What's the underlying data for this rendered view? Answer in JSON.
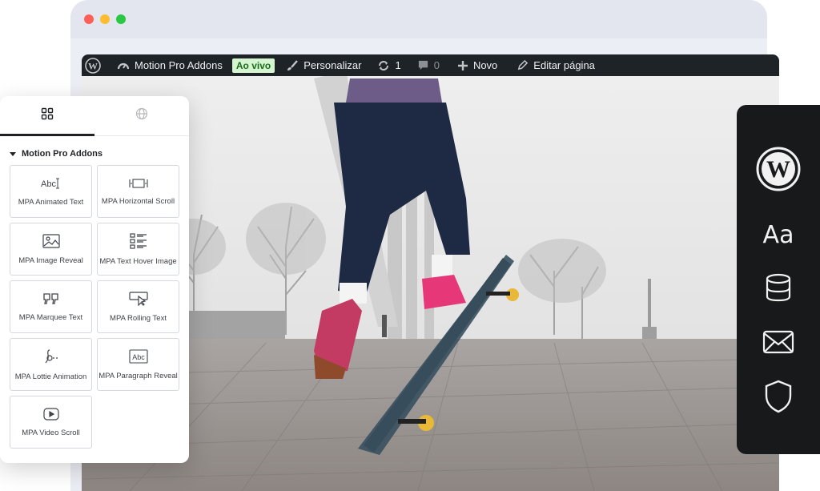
{
  "browser": {
    "dots": [
      "#fe5f57",
      "#febc2e",
      "#28c840"
    ]
  },
  "adminbar": {
    "site_name": "Motion Pro Addons",
    "live_badge": "Ao vivo",
    "customize": "Personalizar",
    "updates_count": "1",
    "comments_count": "0",
    "new_label": "Novo",
    "edit_page": "Editar página",
    "icons": [
      "wordpress-icon",
      "dashboard-icon",
      "brush-icon",
      "refresh-icon",
      "comment-icon",
      "plus-icon",
      "pencil-icon"
    ]
  },
  "panel": {
    "tabs": [
      {
        "icon": "grid-icon",
        "active": true
      },
      {
        "icon": "globe-icon",
        "active": false
      }
    ],
    "section_title": "Motion Pro Addons",
    "widgets": [
      {
        "label": "MPA Animated Text",
        "icon": "animated-text-icon"
      },
      {
        "label": "MPA Horizontal Scroll",
        "icon": "horizontal-scroll-icon"
      },
      {
        "label": "MPA Image Reveal",
        "icon": "image-icon"
      },
      {
        "label": "MPA Text Hover Image",
        "icon": "list-image-icon"
      },
      {
        "label": "MPA Marquee Text",
        "icon": "quote-icon"
      },
      {
        "label": "MPA Rolling Text",
        "icon": "pointer-icon"
      },
      {
        "label": "MPA Lottie Animation",
        "icon": "lottie-icon"
      },
      {
        "label": "MPA Paragraph Reveal",
        "icon": "paragraph-icon"
      },
      {
        "label": "MPA Video Scroll",
        "icon": "video-icon"
      }
    ]
  },
  "dock": {
    "items": [
      {
        "icon": "wordpress-logo-icon"
      },
      {
        "icon": "typography-icon",
        "text": "Aa"
      },
      {
        "icon": "database-icon"
      },
      {
        "icon": "mail-icon"
      },
      {
        "icon": "shield-icon"
      }
    ],
    "background": "#17191b"
  },
  "accent": {
    "live_badge_bg": "#d4f5d0",
    "adminbar_bg": "#1d2327"
  }
}
